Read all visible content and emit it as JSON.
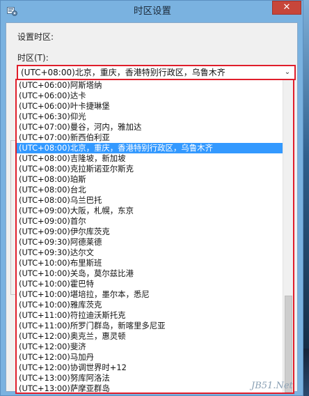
{
  "dialog": {
    "title": "时区设置",
    "close_symbol": "✕",
    "section_label": "设置时区:",
    "field_label": "时区(T):"
  },
  "combo": {
    "selected_value": "(UTC+08:00)北京，重庆，香港特别行政区，乌鲁木齐",
    "arrow": "⌄"
  },
  "timezones": [
    "(UTC+06:00)阿斯塔纳",
    "(UTC+06:00)达卡",
    "(UTC+06:00)叶卡捷琳堡",
    "(UTC+06:30)仰光",
    "(UTC+07:00)曼谷，河内，雅加达",
    "(UTC+07:00)新西伯利亚",
    "(UTC+08:00)北京，重庆，香港特别行政区，乌鲁木齐",
    "(UTC+08:00)吉隆坡，新加坡",
    "(UTC+08:00)克拉斯诺亚尔斯克",
    "(UTC+08:00)珀斯",
    "(UTC+08:00)台北",
    "(UTC+08:00)乌兰巴托",
    "(UTC+09:00)大阪，札幌，东京",
    "(UTC+09:00)首尔",
    "(UTC+09:00)伊尔库茨克",
    "(UTC+09:30)阿德莱德",
    "(UTC+09:30)达尔文",
    "(UTC+10:00)布里斯班",
    "(UTC+10:00)关岛，莫尔兹比港",
    "(UTC+10:00)霍巴特",
    "(UTC+10:00)堪培拉，墨尔本，悉尼",
    "(UTC+10:00)雅库茨克",
    "(UTC+11:00)符拉迪沃斯托克",
    "(UTC+11:00)所罗门群岛，新喀里多尼亚",
    "(UTC+12:00)奥克兰，惠灵顿",
    "(UTC+12:00)斐济",
    "(UTC+12:00)马加丹",
    "(UTC+12:00)协调世界时+12",
    "(UTC+13:00)努库阿洛法",
    "(UTC+13:00)萨摩亚群岛"
  ],
  "selected_index": 6,
  "watermark": "JB51.Net",
  "colors": {
    "highlight": "#e01e2b",
    "selection": "#3399ff",
    "close_button": "#c7463a"
  }
}
